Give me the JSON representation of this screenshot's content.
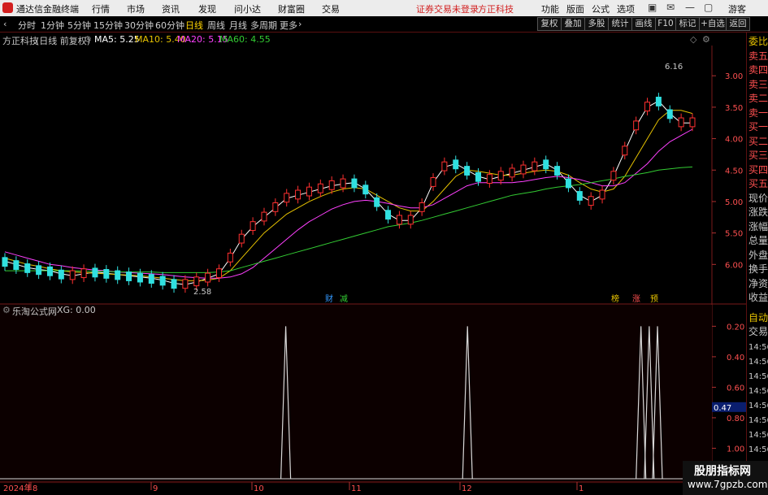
{
  "menu": {
    "app_title": "通达信金融终端",
    "items": [
      "行情",
      "市场",
      "资讯",
      "发现",
      "问小达",
      "财富圈",
      "交易"
    ],
    "notice": "证券交易未登录",
    "broker": "方正科技",
    "right_items": [
      "功能",
      "版面",
      "公式",
      "选项"
    ],
    "user": "游客"
  },
  "toolbar": {
    "periods": [
      "分时",
      "1分钟",
      "5分钟",
      "15分钟",
      "30分钟",
      "60分钟",
      "日线",
      "周线",
      "月线",
      "多周期",
      "更多"
    ],
    "active": "日线",
    "right_buttons": [
      "复权",
      "叠加",
      "多股",
      "统计",
      "画线",
      "F10",
      "标记",
      "+自选",
      "返回"
    ]
  },
  "main_chart": {
    "stock": "方正科技",
    "mode": "(日线 前复权)",
    "ma": [
      {
        "label": "MA5: 5.25",
        "color": "#ffffff"
      },
      {
        "label": "MA10: 5.40",
        "color": "#e6c200"
      },
      {
        "label": "MA20: 5.15",
        "color": "#ff40ff"
      },
      {
        "label": "MA60: 4.55",
        "color": "#33cc33"
      }
    ],
    "y_ticks": [
      "6.00",
      "5.50",
      "5.00",
      "4.50",
      "4.00",
      "3.50",
      "3.00"
    ],
    "high_label": "6.16",
    "low_label": "2.58",
    "event_badges": [
      "财",
      "减",
      "榜",
      "涨",
      "预"
    ]
  },
  "sub_chart": {
    "name": "乐淘公式网",
    "value_label": "XG: 0.00",
    "y_ticks": [
      "1.00",
      "0.80",
      "0.60",
      "0.40",
      "0.20"
    ],
    "cursor_value": "0.47"
  },
  "x_axis": {
    "labels": [
      "2024年",
      "8",
      "9",
      "10",
      "11",
      "12",
      "1"
    ]
  },
  "right_panel": {
    "items": [
      "委比",
      "卖五",
      "卖四",
      "卖三",
      "卖二",
      "卖一",
      "买一",
      "买二",
      "买三",
      "买四",
      "买五",
      "现价",
      "涨跌",
      "涨幅",
      "总量",
      "外盘",
      "换手",
      "净资",
      "收益"
    ],
    "lower_items": [
      "自动",
      "交易"
    ],
    "times": [
      "14:56",
      "14:56",
      "14:56",
      "14:56",
      "14:56",
      "14:56",
      "14:56",
      "14:56",
      "14:56",
      "14:56"
    ]
  },
  "watermark": {
    "line1": "股朋指标网",
    "line2": "www.7gpzb.com"
  },
  "chart_data": [
    {
      "type": "candlestick",
      "title": "方正科技 (日线 前复权)",
      "ylim": [
        2.5,
        6.3
      ],
      "y_ticks": [
        3.0,
        3.5,
        4.0,
        4.5,
        5.0,
        5.5,
        6.0
      ],
      "x_labels": [
        "2024年",
        "8",
        "9",
        "10",
        "11",
        "12",
        "1"
      ],
      "annotations": [
        {
          "text": "6.16",
          "value": 6.16
        },
        {
          "text": "2.58",
          "value": 2.58
        }
      ],
      "series": [
        {
          "name": "MA5",
          "color": "#ffffff",
          "values": [
            3.05,
            3.0,
            2.95,
            2.92,
            2.9,
            2.85,
            2.82,
            2.85,
            2.88,
            2.86,
            2.84,
            2.82,
            2.8,
            2.78,
            2.75,
            2.7,
            2.68,
            2.72,
            2.78,
            2.85,
            3.1,
            3.4,
            3.6,
            3.75,
            3.9,
            4.05,
            4.1,
            4.15,
            4.2,
            4.25,
            4.28,
            4.3,
            4.2,
            4.0,
            3.8,
            3.7,
            3.7,
            3.9,
            4.3,
            4.55,
            4.6,
            4.5,
            4.4,
            4.35,
            4.4,
            4.45,
            4.5,
            4.55,
            4.6,
            4.5,
            4.3,
            4.1,
            4.0,
            4.1,
            4.4,
            4.8,
            5.2,
            5.5,
            5.6,
            5.4,
            5.25,
            5.25
          ]
        },
        {
          "name": "MA10",
          "color": "#e6c200",
          "values": [
            3.1,
            3.05,
            3.0,
            2.97,
            2.93,
            2.9,
            2.88,
            2.87,
            2.86,
            2.85,
            2.84,
            2.83,
            2.82,
            2.8,
            2.78,
            2.76,
            2.74,
            2.74,
            2.75,
            2.78,
            2.9,
            3.1,
            3.3,
            3.5,
            3.65,
            3.8,
            3.9,
            4.0,
            4.08,
            4.15,
            4.2,
            4.22,
            4.2,
            4.1,
            4.0,
            3.9,
            3.85,
            3.85,
            4.0,
            4.2,
            4.4,
            4.5,
            4.48,
            4.45,
            4.42,
            4.42,
            4.45,
            4.48,
            4.5,
            4.48,
            4.42,
            4.3,
            4.2,
            4.15,
            4.2,
            4.4,
            4.7,
            5.0,
            5.3,
            5.45,
            5.45,
            5.4
          ]
        },
        {
          "name": "MA20",
          "color": "#ff40ff",
          "values": [
            3.2,
            3.15,
            3.1,
            3.05,
            3.0,
            2.98,
            2.95,
            2.93,
            2.91,
            2.9,
            2.88,
            2.87,
            2.86,
            2.85,
            2.84,
            2.82,
            2.8,
            2.79,
            2.78,
            2.78,
            2.8,
            2.85,
            2.95,
            3.1,
            3.25,
            3.4,
            3.55,
            3.68,
            3.78,
            3.88,
            3.95,
            4.0,
            4.02,
            4.0,
            3.97,
            3.93,
            3.9,
            3.9,
            3.95,
            4.05,
            4.15,
            4.25,
            4.3,
            4.3,
            4.3,
            4.3,
            4.32,
            4.35,
            4.38,
            4.4,
            4.38,
            4.35,
            4.3,
            4.25,
            4.25,
            4.3,
            4.45,
            4.6,
            4.8,
            4.95,
            5.05,
            5.15
          ]
        },
        {
          "name": "MA60",
          "color": "#33cc33",
          "values": [
            2.9,
            2.9,
            2.9,
            2.9,
            2.9,
            2.9,
            2.9,
            2.89,
            2.89,
            2.89,
            2.88,
            2.88,
            2.88,
            2.88,
            2.87,
            2.87,
            2.87,
            2.87,
            2.87,
            2.88,
            2.9,
            2.95,
            3.0,
            3.05,
            3.1,
            3.15,
            3.2,
            3.25,
            3.3,
            3.35,
            3.4,
            3.45,
            3.5,
            3.55,
            3.6,
            3.63,
            3.66,
            3.7,
            3.75,
            3.8,
            3.85,
            3.9,
            3.95,
            4.0,
            4.05,
            4.1,
            4.13,
            4.16,
            4.2,
            4.23,
            4.25,
            4.27,
            4.3,
            4.33,
            4.36,
            4.4,
            4.43,
            4.46,
            4.5,
            4.52,
            4.54,
            4.55
          ]
        }
      ]
    },
    {
      "type": "line",
      "title": "乐淘公式网 XG",
      "ylim": [
        0,
        1.05
      ],
      "y_ticks": [
        0.2,
        0.4,
        0.6,
        0.8,
        1.0
      ],
      "series": [
        {
          "name": "XG",
          "signal_bars": [
            34,
            56,
            77,
            78,
            79
          ],
          "total_bars": 86
        }
      ]
    }
  ]
}
